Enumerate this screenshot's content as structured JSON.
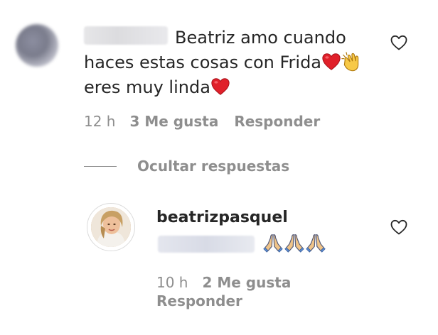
{
  "comment": {
    "line1": "Beatriz amo cuando",
    "line2": "haces estas cosas con Frida",
    "line3": "eres muy linda",
    "time": "12 h",
    "likes": "3 Me gusta",
    "reply": "Responder"
  },
  "hide_replies": "Ocultar respuestas",
  "reply": {
    "username": "beatrizpasquel",
    "time": "10 h",
    "likes": "2 Me gusta",
    "reply": "Responder"
  },
  "icons": {
    "like": "heart-outline-icon",
    "emoji_heart": "red-heart-emoji",
    "emoji_clap": "clapping-hands-emoji",
    "emoji_pray": "folded-hands-emoji"
  },
  "colors": {
    "text": "#262626",
    "secondary": "#8e8e8e",
    "heart_red": "#e0202a"
  }
}
